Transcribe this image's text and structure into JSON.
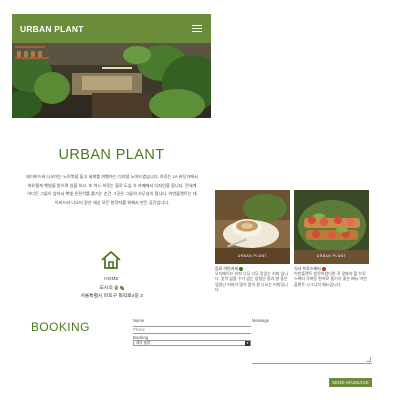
{
  "header": {
    "brand": "URBAN PLANT",
    "menu_icon": "hamburger-menu-icon"
  },
  "main": {
    "title": "URBAN PLANT",
    "intro": "데이비드와 나오미는 노트북을 들고 세계를 여행하는 디지털 노마드였습니다. 하루는 LA 바닷가에서 여유롭게 햇빛을 받으며 일을 하고, 또 어느 하루는 볼로 도심 속 카페에서 디자인을 합니다. 전세계 어디든 그들이 앉아서 햇빛 온전히를 즐기는 순간 그곳은 그들의 사무실이 됩니다. 어반플랜트는 데이비드와 나오미 같은 세상 모든 창작자를 위해서 만든 공간입니다."
  },
  "location": {
    "icon": "home-icon",
    "label": "HOME",
    "city": "도시의 숲",
    "address": "서울특별시 마포구 독막로4길 3"
  },
  "cards": [
    {
      "badge": "URBAN PLANT",
      "name": "음료 어반커피",
      "desc": "오더메이드 커피 너무 너무 맛있는 커피 입니다. 맛이 없을 수가 없는 엄청난 맛과 향 좋은 엄청난 커피가 많이 많이 잘 나오는 커피입니다.",
      "dot_color": "#3f7a2a"
    },
    {
      "badge": "URBAN PLANT",
      "name": "식사 브루스케타",
      "desc": "어반플랜트 방문하셨다면 꼭 맛봐야 할 브루스케타 가벼운 한끼로 즐기기 좋은 메뉴 어반플랜트 시그니처 메뉴입니다.",
      "dot_color": "#c0392b"
    }
  ],
  "booking": {
    "title": "BOOKING",
    "name_label": "Name",
    "phone_placeholder": "Phone",
    "booking_label": "Booking",
    "booking_selected": "예약 종류",
    "message_label": "Message",
    "send_label": "SEND MASSAGE"
  },
  "colors": {
    "accent": "#6b8c3a",
    "title_green": "#4c7a24"
  }
}
